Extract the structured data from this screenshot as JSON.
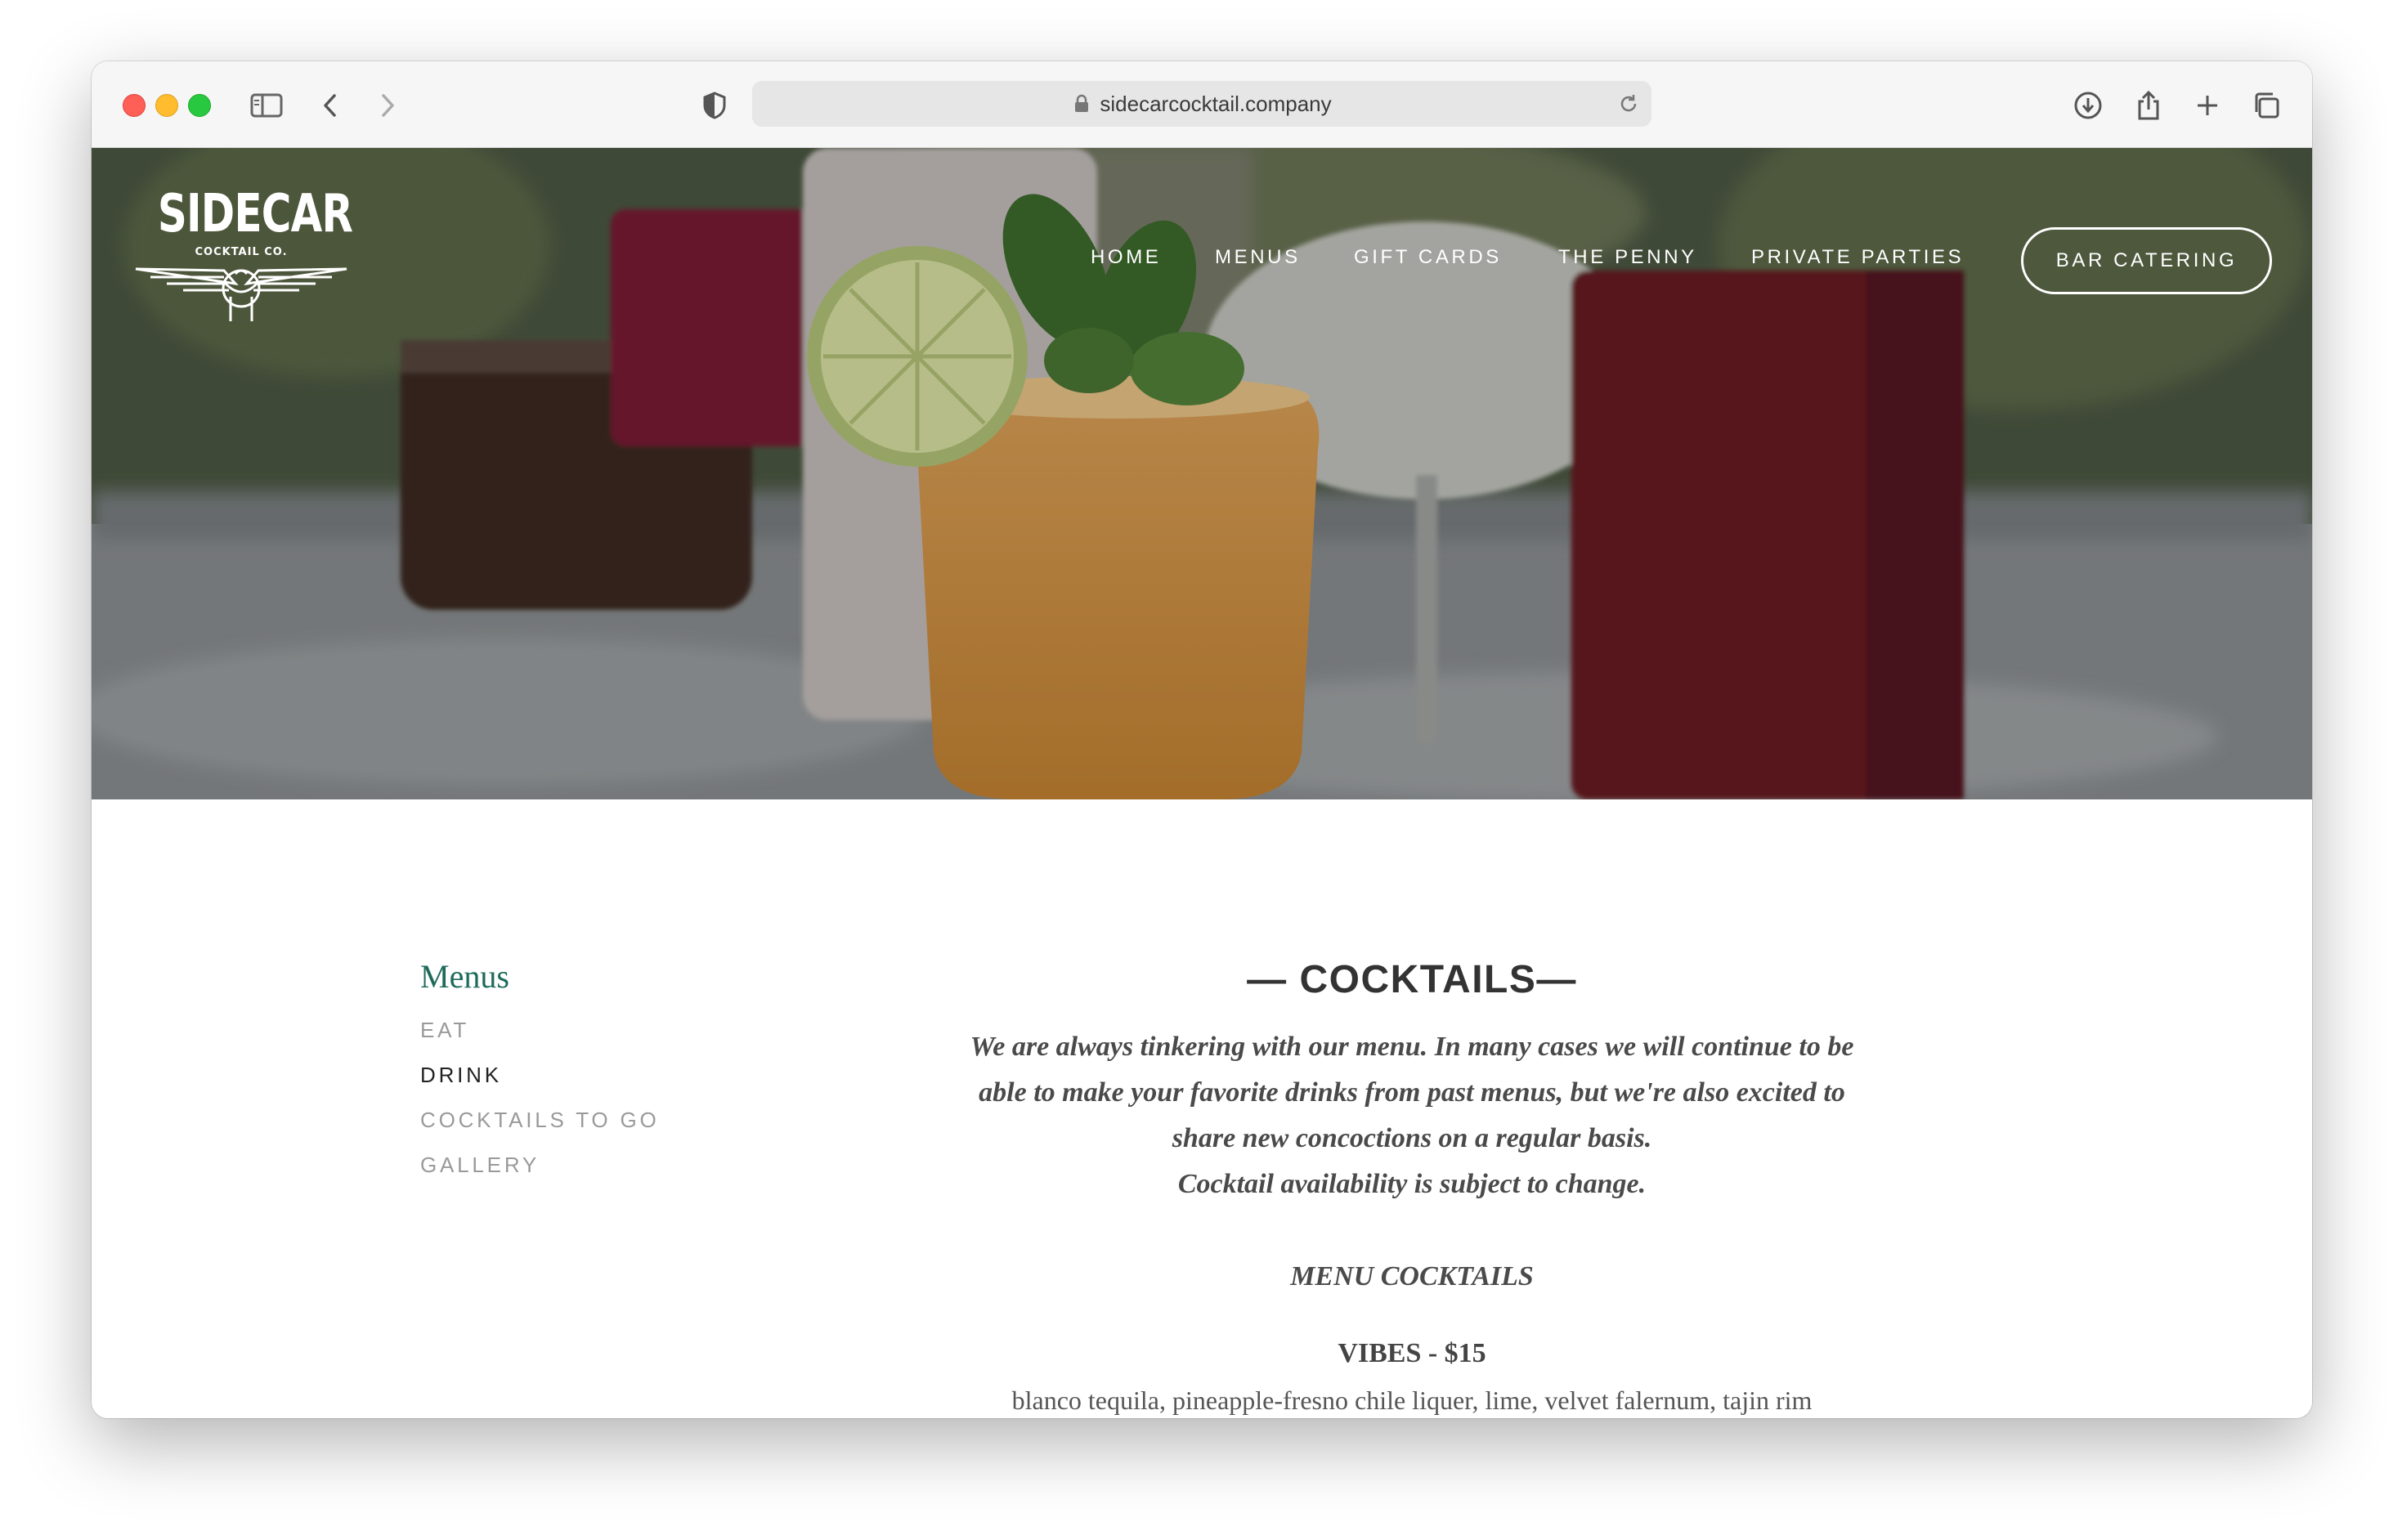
{
  "browser": {
    "url": "sidecarcocktail.company"
  },
  "site": {
    "logo_text": "SIDECAR",
    "logo_subtext": "COCKTAIL CO.",
    "nav": [
      {
        "label": "HOME"
      },
      {
        "label": "MENUS"
      },
      {
        "label": "GIFT CARDS"
      },
      {
        "label": "THE PENNY"
      },
      {
        "label": "PRIVATE PARTIES"
      }
    ],
    "cta_label": "BAR CATERING"
  },
  "sidebar": {
    "title": "Menus",
    "links": [
      {
        "label": "EAT",
        "active": false
      },
      {
        "label": "DRINK",
        "active": true
      },
      {
        "label": "COCKTAILS TO GO",
        "active": false
      },
      {
        "label": "GALLERY",
        "active": false
      }
    ]
  },
  "content": {
    "heading": "— COCKTAILS—",
    "intro_lines": [
      "We are always tinkering with our menu. In many cases we will continue to be",
      "able to make your favorite drinks from past menus, but we're also excited to",
      "share new concoctions on a regular basis.",
      "Cocktail availability is subject to change."
    ],
    "section_heading": "MENU COCKTAILS",
    "items": [
      {
        "name": "VIBES - $15",
        "description": "blanco tequila, pineapple-fresno chile liquer, lime, velvet falernum, tajin rim"
      }
    ]
  },
  "colors": {
    "accent_green": "#1e6b5c",
    "text_dark": "#333333",
    "muted": "#9a9a9a"
  }
}
